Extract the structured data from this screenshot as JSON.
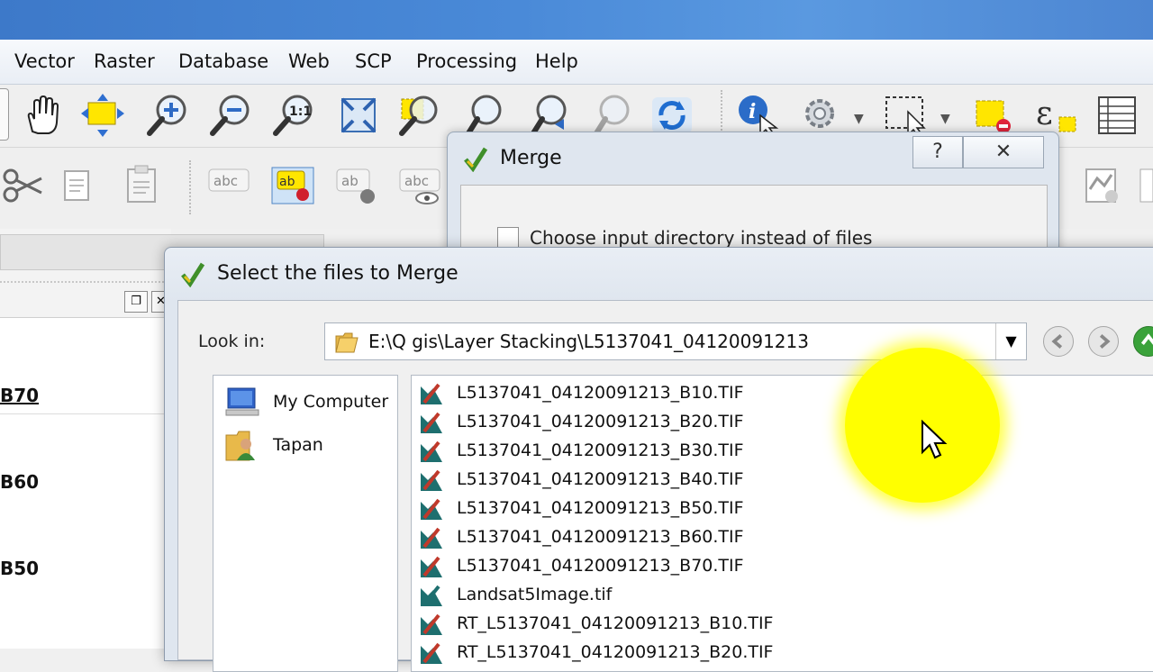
{
  "menu": {
    "items": [
      "Vector",
      "Raster",
      "Database",
      "Web",
      "SCP",
      "Processing",
      "Help"
    ]
  },
  "toolbar1": {
    "icons": [
      "pan-hand-icon",
      "pan-to-selection-icon",
      "zoom-in-icon",
      "zoom-out-icon",
      "zoom-native-icon",
      "zoom-full-icon",
      "zoom-to-selection-icon",
      "zoom-to-layer-icon",
      "zoom-last-icon",
      "zoom-next-icon",
      "refresh-icon",
      "identify-icon",
      "run-action-icon",
      "select-features-icon",
      "deselect-icon",
      "expression-select-icon",
      "attribute-table-icon"
    ]
  },
  "toolbar2": {
    "icons": [
      "cut-icon",
      "copy-icon",
      "paste-icon",
      "label-icon",
      "pin-label-icon",
      "move-label-icon",
      "show-label-icon"
    ],
    "label_text": "abc",
    "label_text_short": "ab"
  },
  "left_panel": {
    "bands": [
      "B70",
      "B60",
      "B50"
    ]
  },
  "merge_dialog": {
    "title": "Merge",
    "help_label": "?",
    "close_label": "✕",
    "checkbox_label": "Choose input directory instead of files",
    "checked": false
  },
  "file_dialog": {
    "title": "Select the files to Merge",
    "look_in_label": "Look in:",
    "look_in_path": "E:\\Q gis\\Layer Stacking\\L5137041_04120091213",
    "places": [
      {
        "label": "My Computer",
        "icon": "computer-icon"
      },
      {
        "label": "Tapan",
        "icon": "user-folder-icon"
      }
    ],
    "files": [
      "L5137041_04120091213_B10.TIF",
      "L5137041_04120091213_B20.TIF",
      "L5137041_04120091213_B30.TIF",
      "L5137041_04120091213_B40.TIF",
      "L5137041_04120091213_B50.TIF",
      "L5137041_04120091213_B60.TIF",
      "L5137041_04120091213_B70.TIF",
      "Landsat5Image.tif",
      "RT_L5137041_04120091213_B10.TIF",
      "RT_L5137041_04120091213_B20.TIF"
    ]
  },
  "colors": {
    "title_blue": "#4a8ad8",
    "highlight": "#ffff00",
    "raster_icon_red": "#c0392b",
    "raster_icon_teal": "#1e6f6f"
  }
}
